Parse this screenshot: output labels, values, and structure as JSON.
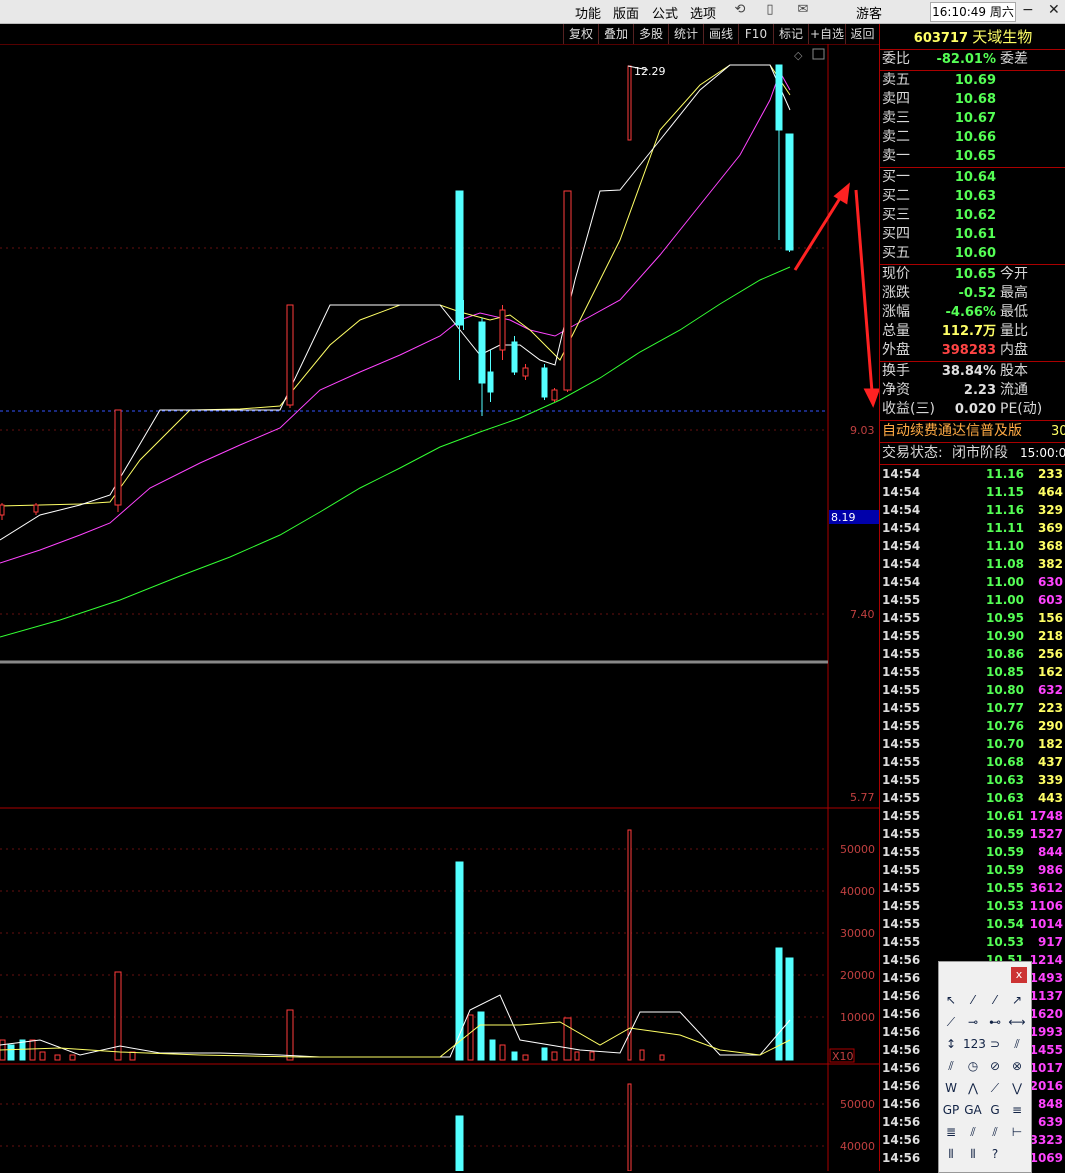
{
  "menu": {
    "items": [
      "功能",
      "版面",
      "公式",
      "选项"
    ],
    "user": "游客",
    "clock": "16:10:49 周六",
    "icons": [
      "refresh-icon",
      "phone-icon",
      "mail-icon"
    ]
  },
  "toolbar": {
    "items": [
      "复权",
      "叠加",
      "多股",
      "统计",
      "画线",
      "F10",
      "标记",
      "+自选",
      "返回"
    ]
  },
  "chart": {
    "price_axis": [
      "9.03",
      "8.19",
      "7.40",
      "5.77"
    ],
    "highlight_price": "8.19",
    "high_label": "12.29",
    "volume_axis": [
      "50000",
      "40000",
      "30000",
      "20000",
      "10000"
    ],
    "volume_unit": "X10",
    "volume2_axis": [
      "50000",
      "40000"
    ],
    "colors": {
      "up": "#ff3b3b",
      "down": "#54ffff",
      "ma5": "#ffffff",
      "ma10": "#ffff66",
      "ma20": "#ff44ff",
      "ma60": "#33ff33",
      "annotation": "#ff2222"
    }
  },
  "quote": {
    "code": "603717",
    "name": "天域生物",
    "weibi_label": "委比",
    "weibi": "-82.01%",
    "weicha_label": "委差",
    "asks": [
      {
        "label": "卖五",
        "price": "10.69"
      },
      {
        "label": "卖四",
        "price": "10.68"
      },
      {
        "label": "卖三",
        "price": "10.67"
      },
      {
        "label": "卖二",
        "price": "10.66"
      },
      {
        "label": "卖一",
        "price": "10.65"
      }
    ],
    "bids": [
      {
        "label": "买一",
        "price": "10.64"
      },
      {
        "label": "买二",
        "price": "10.63"
      },
      {
        "label": "买三",
        "price": "10.62"
      },
      {
        "label": "买四",
        "price": "10.61"
      },
      {
        "label": "买五",
        "price": "10.60"
      }
    ],
    "stats1": [
      {
        "label": "现价",
        "value": "10.65",
        "color": "#55ff55",
        "label2": "今开"
      },
      {
        "label": "涨跌",
        "value": "-0.52",
        "color": "#55ff55",
        "label2": "最高"
      },
      {
        "label": "涨幅",
        "value": "-4.66%",
        "color": "#55ff55",
        "label2": "最低"
      },
      {
        "label": "总量",
        "value": "112.7万",
        "color": "#ffff66",
        "label2": "量比"
      },
      {
        "label": "外盘",
        "value": "398283",
        "color": "#ff4444",
        "label2": "内盘"
      }
    ],
    "stats2": [
      {
        "label": "换手",
        "value": "38.84%",
        "color": "#e0e0e0",
        "label2": "股本"
      },
      {
        "label": "净资",
        "value": "2.23",
        "color": "#e0e0e0",
        "label2": "流通"
      },
      {
        "label": "收益(三)",
        "value": "0.020",
        "color": "#e0e0e0",
        "label2": "PE(动)"
      }
    ],
    "promo": "自动续费通达信普及版",
    "promo_num": "30",
    "status_label": "交易状态:",
    "status": "闭市阶段",
    "status_time": "15:00:0",
    "ticks": [
      {
        "t": "14:54",
        "p": "11.16",
        "v": "233",
        "vc": "#ffff66"
      },
      {
        "t": "14:54",
        "p": "11.15",
        "v": "464",
        "vc": "#ffff66"
      },
      {
        "t": "14:54",
        "p": "11.16",
        "v": "329",
        "vc": "#ffff66"
      },
      {
        "t": "14:54",
        "p": "11.11",
        "v": "369",
        "vc": "#ffff66"
      },
      {
        "t": "14:54",
        "p": "11.10",
        "v": "368",
        "vc": "#ffff66"
      },
      {
        "t": "14:54",
        "p": "11.08",
        "v": "382",
        "vc": "#ffff66"
      },
      {
        "t": "14:54",
        "p": "11.00",
        "v": "630",
        "vc": "#ff44ff"
      },
      {
        "t": "14:55",
        "p": "11.00",
        "v": "603",
        "vc": "#ff44ff"
      },
      {
        "t": "14:55",
        "p": "10.95",
        "v": "156",
        "vc": "#ffff66"
      },
      {
        "t": "14:55",
        "p": "10.90",
        "v": "218",
        "vc": "#ffff66"
      },
      {
        "t": "14:55",
        "p": "10.86",
        "v": "256",
        "vc": "#ffff66"
      },
      {
        "t": "14:55",
        "p": "10.85",
        "v": "162",
        "vc": "#ffff66"
      },
      {
        "t": "14:55",
        "p": "10.80",
        "v": "632",
        "vc": "#ff44ff"
      },
      {
        "t": "14:55",
        "p": "10.77",
        "v": "223",
        "vc": "#ffff66"
      },
      {
        "t": "14:55",
        "p": "10.76",
        "v": "290",
        "vc": "#ffff66"
      },
      {
        "t": "14:55",
        "p": "10.70",
        "v": "182",
        "vc": "#ffff66"
      },
      {
        "t": "14:55",
        "p": "10.68",
        "v": "437",
        "vc": "#ffff66"
      },
      {
        "t": "14:55",
        "p": "10.63",
        "v": "339",
        "vc": "#ffff66"
      },
      {
        "t": "14:55",
        "p": "10.63",
        "v": "443",
        "vc": "#ffff66"
      },
      {
        "t": "14:55",
        "p": "10.61",
        "v": "1748",
        "vc": "#ff44ff"
      },
      {
        "t": "14:55",
        "p": "10.59",
        "v": "1527",
        "vc": "#ff44ff"
      },
      {
        "t": "14:55",
        "p": "10.59",
        "v": "844",
        "vc": "#ff44ff"
      },
      {
        "t": "14:55",
        "p": "10.59",
        "v": "986",
        "vc": "#ff44ff"
      },
      {
        "t": "14:55",
        "p": "10.55",
        "v": "3612",
        "vc": "#ff44ff"
      },
      {
        "t": "14:55",
        "p": "10.53",
        "v": "1106",
        "vc": "#ff44ff"
      },
      {
        "t": "14:55",
        "p": "10.54",
        "v": "1014",
        "vc": "#ff44ff"
      },
      {
        "t": "14:55",
        "p": "10.53",
        "v": "917",
        "vc": "#ff44ff"
      },
      {
        "t": "14:56",
        "p": "10.51",
        "v": "1214",
        "vc": "#ff44ff"
      },
      {
        "t": "14:56",
        "p": "",
        "v": "1493",
        "vc": "#ff44ff"
      },
      {
        "t": "14:56",
        "p": "",
        "v": "1137",
        "vc": "#ff44ff"
      },
      {
        "t": "14:56",
        "p": "",
        "v": "1620",
        "vc": "#ff44ff"
      },
      {
        "t": "14:56",
        "p": "",
        "v": "1993",
        "vc": "#ff44ff"
      },
      {
        "t": "14:56",
        "p": "",
        "v": "1455",
        "vc": "#ff44ff"
      },
      {
        "t": "14:56",
        "p": "",
        "v": "1017",
        "vc": "#ff44ff"
      },
      {
        "t": "14:56",
        "p": "",
        "v": "2016",
        "vc": "#ff44ff"
      },
      {
        "t": "14:56",
        "p": "",
        "v": "848",
        "vc": "#ff44ff"
      },
      {
        "t": "14:56",
        "p": "",
        "v": "639",
        "vc": "#ff44ff"
      },
      {
        "t": "14:56",
        "p": "",
        "v": "3323",
        "vc": "#ff44ff"
      },
      {
        "t": "14:56",
        "p": "",
        "v": "1069",
        "vc": "#ff44ff"
      }
    ]
  },
  "draw_panel": {
    "close_label": "x",
    "tools": [
      "↖",
      "⁄",
      "⁄",
      "↗",
      "⟋",
      "⊸",
      "⊷",
      "⟷",
      "↕",
      "123",
      "⊃",
      "⫽",
      "⫽",
      "◷",
      "⊘",
      "⊗",
      "W",
      "⋀",
      "⟋",
      "⋁",
      "GP",
      "GA",
      "G",
      "≡",
      "≣",
      "⫽",
      "⫽",
      "⊢",
      "⦀",
      "⦀",
      "?"
    ]
  }
}
